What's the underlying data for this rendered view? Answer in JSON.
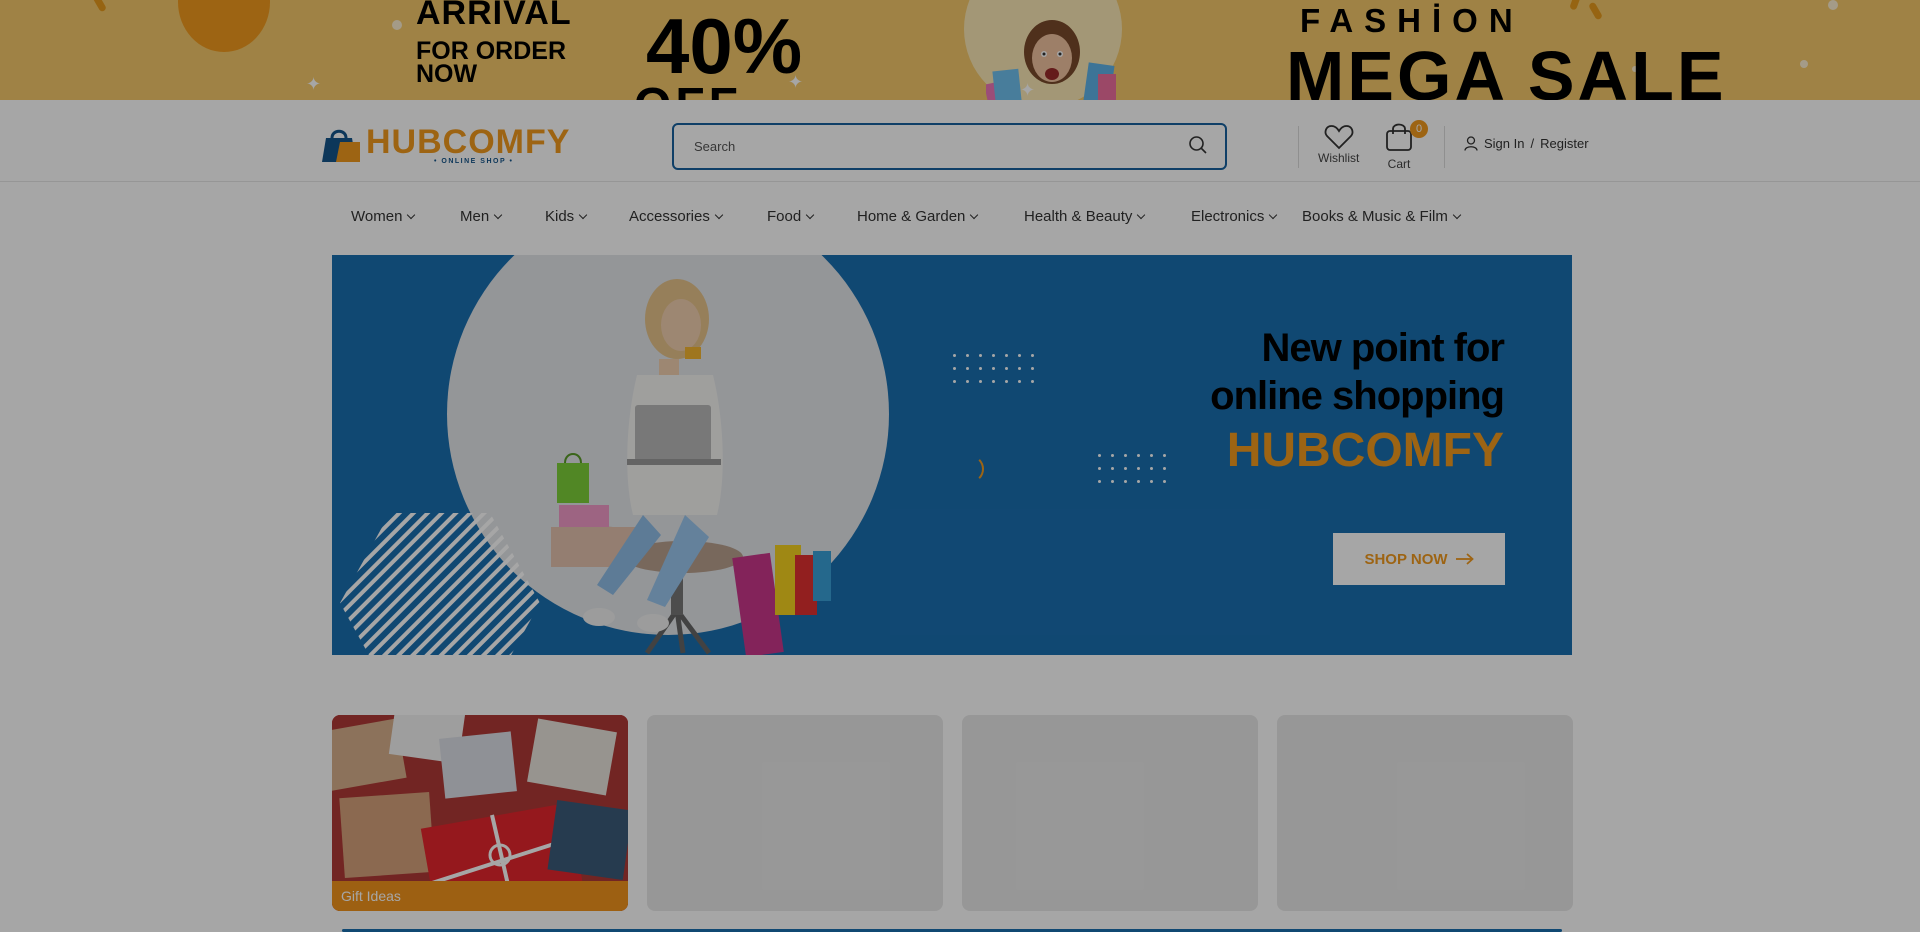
{
  "promo": {
    "arrival": "ARRİVAL",
    "for_order_now": "FOR ORDER NOW",
    "percent": "40%",
    "off": "OFF",
    "fashion": "FASHİON",
    "mega_sale": "MEGA SALE",
    "background_color": "#f4c86a"
  },
  "header": {
    "logo_text": "HUBCOMFY",
    "logo_sub": "• ONLINE SHOP •",
    "search_placeholder": "Search",
    "search_icon": "search-icon",
    "wishlist_label": "Wishlist",
    "wishlist_icon": "heart-icon",
    "cart_label": "Cart",
    "cart_icon": "shopping-bag-icon",
    "cart_count": "0",
    "signin_label": "Sign In",
    "signin_separator": "/",
    "register_label": "Register",
    "user_icon": "user-icon"
  },
  "nav": {
    "items": [
      {
        "label": "Women"
      },
      {
        "label": "Men"
      },
      {
        "label": "Kids"
      },
      {
        "label": "Accessories"
      },
      {
        "label": "Food"
      },
      {
        "label": "Home & Garden"
      },
      {
        "label": "Health & Beauty"
      },
      {
        "label": "Electronics"
      },
      {
        "label": "Books & Music & Film"
      }
    ],
    "chevron_icon": "chevron-down-icon"
  },
  "hero": {
    "line1": "New point for",
    "line2": "online shopping",
    "brand": "HUBCOMFY",
    "button_label": "SHOP NOW",
    "button_icon": "arrow-right-icon",
    "background_color": "#1a6fb0",
    "accent_color": "#f29a1e"
  },
  "categories": [
    {
      "label": "Gift Ideas"
    },
    {
      "label": ""
    },
    {
      "label": ""
    },
    {
      "label": ""
    }
  ],
  "overlay": {
    "state": "dimmed"
  }
}
